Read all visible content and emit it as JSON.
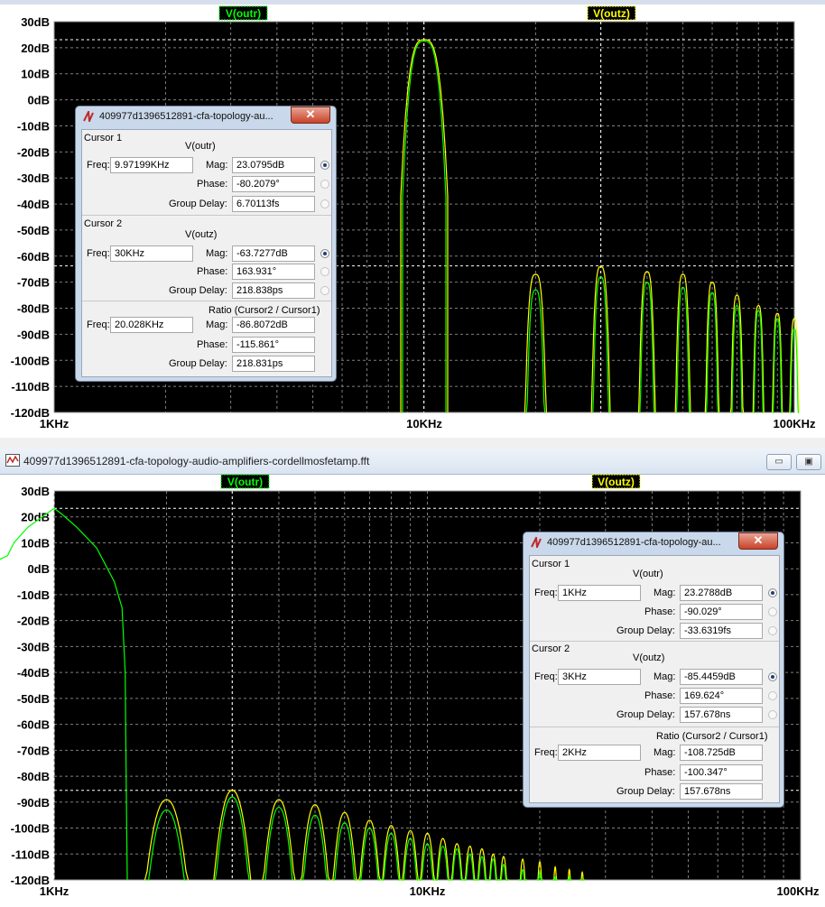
{
  "colors": {
    "plot_bg": "#000000",
    "grid": "#7f7f7f",
    "vouts_trace": "#00ff00",
    "voutz_trace": "#ffff00",
    "pane_bg": "#ffffff"
  },
  "top_pane": {
    "trace_labels": [
      "V(outr)",
      "V(outz)"
    ],
    "y_ticks": [
      "30dB",
      "20dB",
      "10dB",
      "0dB",
      "-10dB",
      "-20dB",
      "-30dB",
      "-40dB",
      "-50dB",
      "-60dB",
      "-70dB",
      "-80dB",
      "-90dB",
      "-100dB",
      "-110dB",
      "-120dB"
    ],
    "x_ticks": [
      "1KHz",
      "10KHz",
      "100KHz"
    ],
    "x_scale": "log",
    "dialog": {
      "title": "409977d1396512891-cfa-topology-au...",
      "close_glyph": "✕",
      "cursor1": {
        "header": "Cursor 1",
        "trace": "V(outr)",
        "freq_label": "Freq:",
        "freq": "9.97199KHz",
        "mag_label": "Mag:",
        "mag": "23.0795dB",
        "phase_label": "Phase:",
        "phase": "-80.2079°",
        "gd_label": "Group Delay:",
        "gd": "6.70113fs"
      },
      "cursor2": {
        "header": "Cursor 2",
        "trace": "V(outz)",
        "freq_label": "Freq:",
        "freq": "30KHz",
        "mag_label": "Mag:",
        "mag": "-63.7277dB",
        "phase_label": "Phase:",
        "phase": "163.931°",
        "gd_label": "Group Delay:",
        "gd": "218.838ps"
      },
      "ratio": {
        "header": "Ratio (Cursor2 / Cursor1)",
        "freq_label": "Freq:",
        "freq": "20.028KHz",
        "mag_label": "Mag:",
        "mag": "-86.8072dB",
        "phase_label": "Phase:",
        "phase": "-115.861°",
        "gd_label": "Group Delay:",
        "gd": "218.831ps"
      }
    }
  },
  "bottom_pane": {
    "window_title": "409977d1396512891-cfa-topology-audio-amplifiers-cordellmosfetamp.fft",
    "min_glyph": "▭",
    "restore_glyph": "▣",
    "trace_labels": [
      "V(outr)",
      "V(outz)"
    ],
    "y_ticks": [
      "30dB",
      "20dB",
      "10dB",
      "0dB",
      "-10dB",
      "-20dB",
      "-30dB",
      "-40dB",
      "-50dB",
      "-60dB",
      "-70dB",
      "-80dB",
      "-90dB",
      "-100dB",
      "-110dB",
      "-120dB"
    ],
    "x_ticks": [
      "1KHz",
      "10KHz",
      "100KHz"
    ],
    "x_scale": "log",
    "dialog": {
      "title": "409977d1396512891-cfa-topology-au...",
      "close_glyph": "✕",
      "cursor1": {
        "header": "Cursor 1",
        "trace": "V(outr)",
        "freq_label": "Freq:",
        "freq": "1KHz",
        "mag_label": "Mag:",
        "mag": "23.2788dB",
        "phase_label": "Phase:",
        "phase": "-90.029°",
        "gd_label": "Group Delay:",
        "gd": "-33.6319fs"
      },
      "cursor2": {
        "header": "Cursor 2",
        "trace": "V(outz)",
        "freq_label": "Freq:",
        "freq": "3KHz",
        "mag_label": "Mag:",
        "mag": "-85.4459dB",
        "phase_label": "Phase:",
        "phase": "169.624°",
        "gd_label": "Group Delay:",
        "gd": "157.678ns"
      },
      "ratio": {
        "header": "Ratio (Cursor2 / Cursor1)",
        "freq_label": "Freq:",
        "freq": "2KHz",
        "mag_label": "Mag:",
        "mag": "-108.725dB",
        "phase_label": "Phase:",
        "phase": "-100.347°",
        "gd_label": "Group Delay:",
        "gd": "157.678ns"
      }
    }
  }
}
